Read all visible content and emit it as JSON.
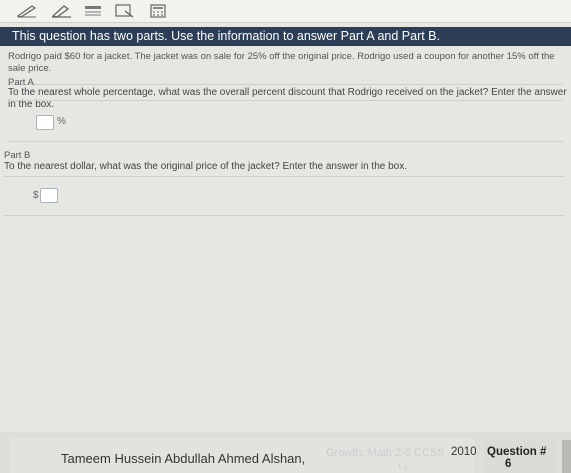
{
  "toolbar": {
    "tools": [
      {
        "name": "pencil-icon"
      },
      {
        "name": "highlighter-icon"
      },
      {
        "name": "line-reader-icon"
      },
      {
        "name": "magnifier-icon"
      },
      {
        "name": "calculator-icon"
      }
    ]
  },
  "banner": {
    "text": "This question has two parts. Use the information to answer Part A and Part B."
  },
  "intro": {
    "text": "Rodrigo paid $60 for a jacket. The jacket was on sale for 25% off the original price. Rodrigo used a coupon for another 15% off the sale price."
  },
  "part_a": {
    "label": "Part A",
    "prompt": "To the nearest whole percentage, what was the overall percent discount that Rodrigo received on the jacket? Enter the answer in the box.",
    "answer_value": "",
    "unit": "%"
  },
  "part_b": {
    "label": "Part B",
    "prompt": "To the nearest dollar, what was the original price of the jacket? Enter the answer in the box.",
    "answer_value": "",
    "prefix": "$"
  },
  "footer": {
    "student_name": "Tameem Hussein Abdullah Ahmed Alshan,",
    "course": "Growth: Math 2-5 CCSS",
    "year": "2010",
    "question_label": "Question #",
    "question_number": "6",
    "small_mark": "1 1"
  }
}
